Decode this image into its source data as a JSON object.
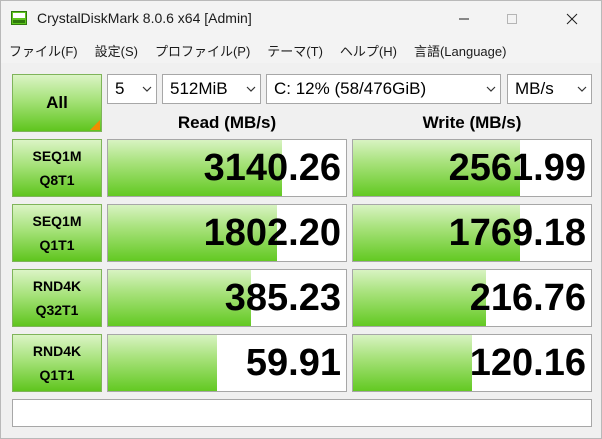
{
  "window": {
    "title": "CrystalDiskMark 8.0.6 x64 [Admin]"
  },
  "menu": [
    {
      "label": "ファイル(F)"
    },
    {
      "label": "設定(S)"
    },
    {
      "label": "プロファイル(P)"
    },
    {
      "label": "テーマ(T)"
    },
    {
      "label": "ヘルプ(H)"
    },
    {
      "label": "言語(Language)"
    }
  ],
  "toolbar": {
    "all_label": "All",
    "count": "5",
    "size": "512MiB",
    "drive": "C: 12% (58/476GiB)",
    "unit": "MB/s"
  },
  "headers": {
    "read": "Read (MB/s)",
    "write": "Write (MB/s)"
  },
  "tests": [
    {
      "line1": "SEQ1M",
      "line2": "Q8T1",
      "read": "3140.26",
      "write": "2561.99",
      "read_fill": 0.73,
      "write_fill": 0.7
    },
    {
      "line1": "SEQ1M",
      "line2": "Q1T1",
      "read": "1802.20",
      "write": "1769.18",
      "read_fill": 0.71,
      "write_fill": 0.7
    },
    {
      "line1": "RND4K",
      "line2": "Q32T1",
      "read": "385.23",
      "write": "216.76",
      "read_fill": 0.6,
      "write_fill": 0.56
    },
    {
      "line1": "RND4K",
      "line2": "Q1T1",
      "read": "59.91",
      "write": "120.16",
      "read_fill": 0.46,
      "write_fill": 0.5
    }
  ],
  "comment": "",
  "colors": {
    "accent_green": "#63c922",
    "corner_orange": "#f08c00"
  }
}
